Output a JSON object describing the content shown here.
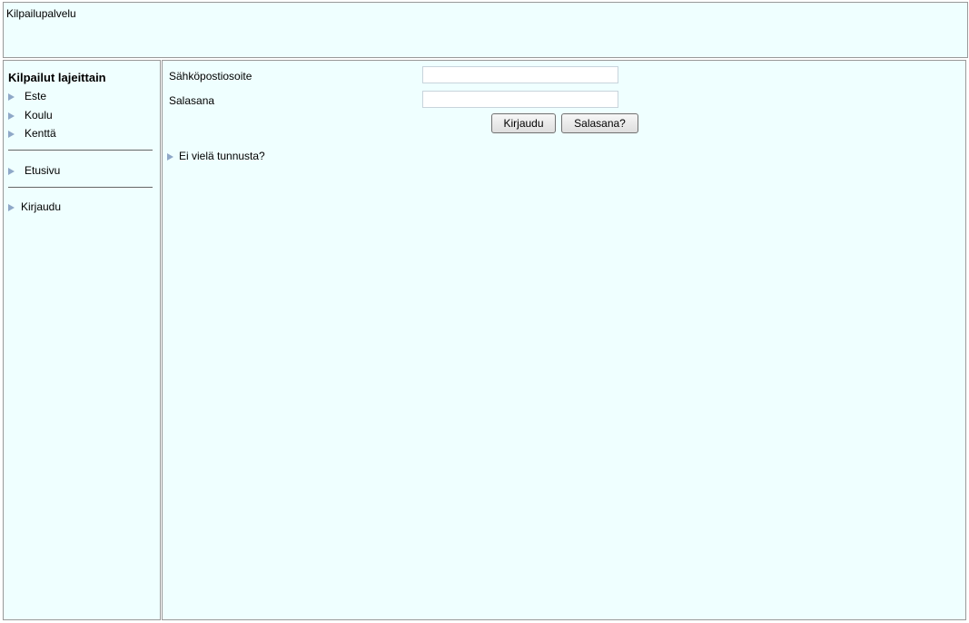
{
  "header": {
    "title": "Kilpailupalvelu"
  },
  "sidebar": {
    "heading": "Kilpailut lajeittain",
    "sports": [
      "Este",
      "Koulu",
      "Kenttä"
    ],
    "home": "Etusivu",
    "login": "Kirjaudu"
  },
  "login_form": {
    "email_label": "Sähköpostiosoite",
    "email_value": "",
    "password_label": "Salasana",
    "password_value": "",
    "login_button": "Kirjaudu",
    "forgot_button": "Salasana?",
    "register_link": "Ei vielä tunnusta?"
  },
  "colors": {
    "panel_bg": "#efffff",
    "border": "#999999",
    "arrow": "#8fa8c8"
  }
}
